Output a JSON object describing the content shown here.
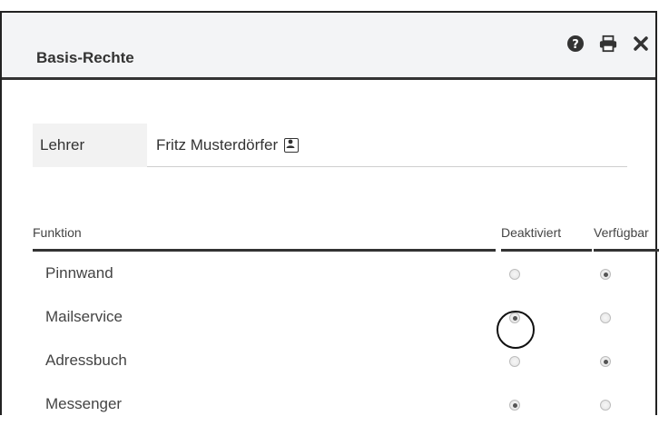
{
  "dialog": {
    "title": "Basis-Rechte"
  },
  "toolbar": {
    "help_icon": "help-circle-icon",
    "print_icon": "printer-icon",
    "close_icon": "close-icon"
  },
  "teacher": {
    "label": "Lehrer",
    "name": "Fritz Musterdörfer",
    "contact_icon": "contact-card-icon"
  },
  "table": {
    "headers": {
      "function": "Funktion",
      "deactivated": "Deaktiviert",
      "available": "Verfügbar"
    },
    "rows": [
      {
        "label": "Pinnwand",
        "selected": "available"
      },
      {
        "label": "Mailservice",
        "selected": "deactivated"
      },
      {
        "label": "Adressbuch",
        "selected": "available"
      },
      {
        "label": "Messenger",
        "selected": "deactivated"
      }
    ]
  },
  "annotation": {
    "highlighted_row": "Mailservice",
    "highlighted_option": "deactivated"
  },
  "colors": {
    "titlebar_bg": "#f3f4f6",
    "border_dark": "#333333",
    "label_bg": "#f2f2f2"
  }
}
